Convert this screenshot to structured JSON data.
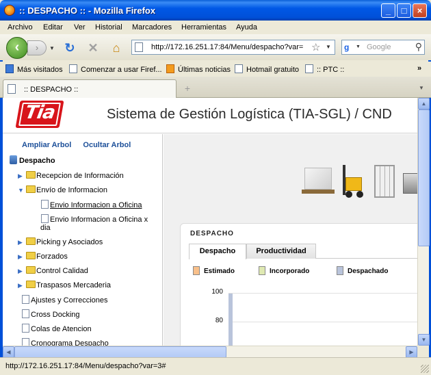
{
  "window": {
    "title": ":: DESPACHO :: - Mozilla Firefox"
  },
  "menu": [
    "Archivo",
    "Editar",
    "Ver",
    "Historial",
    "Marcadores",
    "Herramientas",
    "Ayuda"
  ],
  "nav": {
    "url": "http://172.16.251.17:84/Menu/despacho?var=",
    "search_placeholder": "Google"
  },
  "bookmarks": [
    "Más visitados",
    "Comenzar a usar Firef...",
    "Últimas noticias",
    "Hotmail gratuito",
    ":: PTC ::"
  ],
  "tabs": {
    "active_title": ":: DESPACHO ::"
  },
  "header": {
    "logo_text": "Tia",
    "system_title": "Sistema de Gestión Logística (TIA-SGL) / CND"
  },
  "sidebar": {
    "actions": [
      "Ampliar Arbol",
      "Ocultar Arbol"
    ],
    "root": "Despacho",
    "items": [
      {
        "label": "Recepcion de Información"
      },
      {
        "label": "Envío de Informacion"
      },
      {
        "label": "Envio Informacion a Oficina"
      },
      {
        "label": "Envio Informacion a Oficina x"
      },
      {
        "label": "dia"
      },
      {
        "label": "Picking y Asociados"
      },
      {
        "label": "Forzados"
      },
      {
        "label": "Control Calidad"
      },
      {
        "label": "Traspasos Mercaderia"
      },
      {
        "label": "Ajustes y Correcciones"
      },
      {
        "label": "Cross Docking"
      },
      {
        "label": "Colas de Atencion"
      },
      {
        "label": "Cronograma Despacho"
      }
    ]
  },
  "panel": {
    "title": "DESPACHO",
    "tabs": [
      "Despacho",
      "Productividad"
    ],
    "legend": [
      {
        "label": "Estimado",
        "color": "#f9c08a"
      },
      {
        "label": "Incorporado",
        "color": "#dfe9b2"
      },
      {
        "label": "Despachado",
        "color": "#b9c4db"
      }
    ],
    "y_ticks": [
      "100",
      "80"
    ]
  },
  "status": {
    "text": "http://172.16.251.17:84/Menu/despacho?var=3#"
  }
}
